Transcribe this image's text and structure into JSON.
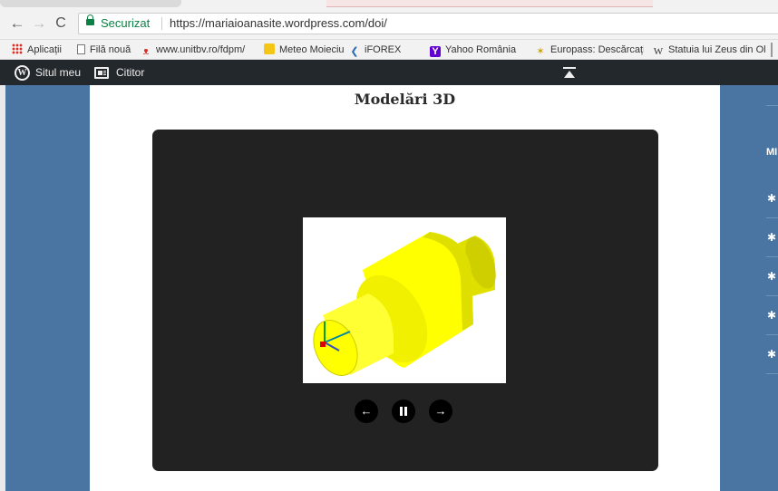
{
  "browser": {
    "nav": {
      "back": "←",
      "forward": "→",
      "reload": "C"
    },
    "secure_label": "Securizat",
    "url": "https://mariaioanasite.wordpress.com/doi/",
    "bookmarks": [
      {
        "label": "Aplicații",
        "icon": "apps-grid-icon"
      },
      {
        "label": "Filă nouă",
        "icon": "page-icon"
      },
      {
        "label": "www.unitbv.ro/fdpm/",
        "icon": "unitbv-icon"
      },
      {
        "label": "Meteo Moieciu judetu",
        "icon": "meteo-icon"
      },
      {
        "label": "iFOREX",
        "icon": "iforex-icon"
      },
      {
        "label": "Yahoo România",
        "icon": "yahoo-icon"
      },
      {
        "label": "Europass: Descărcați f",
        "icon": "europass-icon"
      },
      {
        "label": "Statuia lui Zeus din Ol",
        "icon": "wikipedia-icon"
      }
    ]
  },
  "adminbar": {
    "my_site": "Situl meu",
    "reader": "Cititor"
  },
  "page": {
    "title": "Modelări 3D",
    "slideshow": {
      "prev": "←",
      "next": "→",
      "image_subject": "yellow stepped-cylinder 3D model with XYZ axis triad"
    }
  },
  "sidebar": {
    "widget_title": "MI",
    "item_icons": [
      "gear-icon",
      "gear-icon",
      "gear-icon",
      "gear-icon",
      "gear-icon"
    ]
  },
  "colors": {
    "adminbar": "#23282d",
    "page_bg": "#4a75a3",
    "slideshow_bg": "#222222",
    "model_yellow": "#ffff00",
    "secure_green": "#0b8043"
  }
}
